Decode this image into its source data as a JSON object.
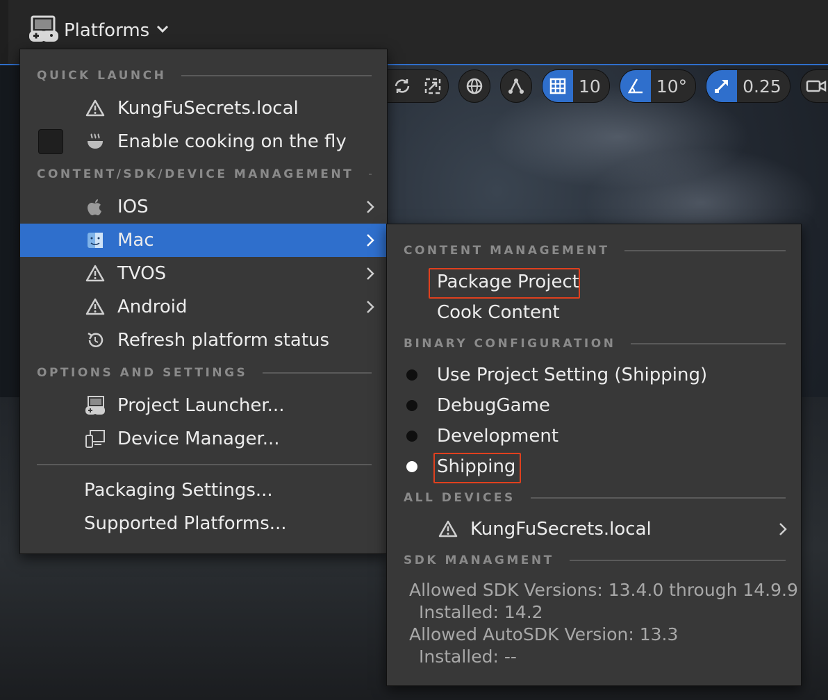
{
  "toolbar": {
    "platforms_label": "Platforms",
    "grid_value": "10",
    "angle_value": "10°",
    "scale_value": "0.25"
  },
  "menu": {
    "quick_launch_header": "QUICK LAUNCH",
    "quick_launch_device": "KungFuSecrets.local",
    "enable_cooking": "Enable cooking on the fly",
    "content_sdk_header": "CONTENT/SDK/DEVICE MANAGEMENT",
    "platforms": [
      {
        "label": "IOS",
        "icon": "apple-icon"
      },
      {
        "label": "Mac",
        "icon": "finder-icon",
        "selected": true
      },
      {
        "label": "TVOS",
        "icon": "warning-icon"
      },
      {
        "label": "Android",
        "icon": "warning-icon"
      }
    ],
    "refresh_status": "Refresh platform status",
    "options_header": "OPTIONS AND SETTINGS",
    "project_launcher": "Project Launcher...",
    "device_manager": "Device Manager...",
    "packaging_settings": "Packaging Settings...",
    "supported_platforms": "Supported Platforms..."
  },
  "submenu": {
    "content_mgmt_header": "CONTENT MANAGEMENT",
    "package_project": "Package Project",
    "cook_content": "Cook Content",
    "binary_config_header": "BINARY CONFIGURATION",
    "configs": [
      {
        "label": "Use Project Setting (Shipping)",
        "selected": false
      },
      {
        "label": "DebugGame",
        "selected": false
      },
      {
        "label": "Development",
        "selected": false
      },
      {
        "label": "Shipping",
        "selected": true
      }
    ],
    "all_devices_header": "ALL DEVICES",
    "device": "KungFuSecrets.local",
    "sdk_header": "SDK MANAGMENT",
    "sdk_line1": "Allowed SDK Versions: 13.4.0 through 14.9.9",
    "sdk_line2": "Installed: 14.2",
    "sdk_line3": "Allowed AutoSDK Version: 13.3",
    "sdk_line4": "Installed: --"
  },
  "colors": {
    "accent": "#2f6fcc",
    "menu_bg": "#383838",
    "highlight": "#e0401e"
  }
}
